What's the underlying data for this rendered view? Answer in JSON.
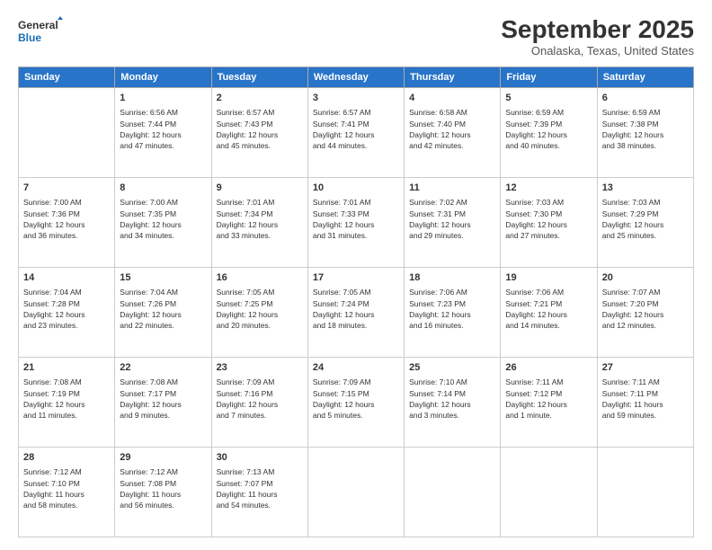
{
  "header": {
    "logo_line1": "General",
    "logo_line2": "Blue",
    "month_title": "September 2025",
    "location": "Onalaska, Texas, United States"
  },
  "days_of_week": [
    "Sunday",
    "Monday",
    "Tuesday",
    "Wednesday",
    "Thursday",
    "Friday",
    "Saturday"
  ],
  "weeks": [
    [
      {
        "day": "",
        "content": ""
      },
      {
        "day": "1",
        "content": "Sunrise: 6:56 AM\nSunset: 7:44 PM\nDaylight: 12 hours\nand 47 minutes."
      },
      {
        "day": "2",
        "content": "Sunrise: 6:57 AM\nSunset: 7:43 PM\nDaylight: 12 hours\nand 45 minutes."
      },
      {
        "day": "3",
        "content": "Sunrise: 6:57 AM\nSunset: 7:41 PM\nDaylight: 12 hours\nand 44 minutes."
      },
      {
        "day": "4",
        "content": "Sunrise: 6:58 AM\nSunset: 7:40 PM\nDaylight: 12 hours\nand 42 minutes."
      },
      {
        "day": "5",
        "content": "Sunrise: 6:59 AM\nSunset: 7:39 PM\nDaylight: 12 hours\nand 40 minutes."
      },
      {
        "day": "6",
        "content": "Sunrise: 6:59 AM\nSunset: 7:38 PM\nDaylight: 12 hours\nand 38 minutes."
      }
    ],
    [
      {
        "day": "7",
        "content": "Sunrise: 7:00 AM\nSunset: 7:36 PM\nDaylight: 12 hours\nand 36 minutes."
      },
      {
        "day": "8",
        "content": "Sunrise: 7:00 AM\nSunset: 7:35 PM\nDaylight: 12 hours\nand 34 minutes."
      },
      {
        "day": "9",
        "content": "Sunrise: 7:01 AM\nSunset: 7:34 PM\nDaylight: 12 hours\nand 33 minutes."
      },
      {
        "day": "10",
        "content": "Sunrise: 7:01 AM\nSunset: 7:33 PM\nDaylight: 12 hours\nand 31 minutes."
      },
      {
        "day": "11",
        "content": "Sunrise: 7:02 AM\nSunset: 7:31 PM\nDaylight: 12 hours\nand 29 minutes."
      },
      {
        "day": "12",
        "content": "Sunrise: 7:03 AM\nSunset: 7:30 PM\nDaylight: 12 hours\nand 27 minutes."
      },
      {
        "day": "13",
        "content": "Sunrise: 7:03 AM\nSunset: 7:29 PM\nDaylight: 12 hours\nand 25 minutes."
      }
    ],
    [
      {
        "day": "14",
        "content": "Sunrise: 7:04 AM\nSunset: 7:28 PM\nDaylight: 12 hours\nand 23 minutes."
      },
      {
        "day": "15",
        "content": "Sunrise: 7:04 AM\nSunset: 7:26 PM\nDaylight: 12 hours\nand 22 minutes."
      },
      {
        "day": "16",
        "content": "Sunrise: 7:05 AM\nSunset: 7:25 PM\nDaylight: 12 hours\nand 20 minutes."
      },
      {
        "day": "17",
        "content": "Sunrise: 7:05 AM\nSunset: 7:24 PM\nDaylight: 12 hours\nand 18 minutes."
      },
      {
        "day": "18",
        "content": "Sunrise: 7:06 AM\nSunset: 7:23 PM\nDaylight: 12 hours\nand 16 minutes."
      },
      {
        "day": "19",
        "content": "Sunrise: 7:06 AM\nSunset: 7:21 PM\nDaylight: 12 hours\nand 14 minutes."
      },
      {
        "day": "20",
        "content": "Sunrise: 7:07 AM\nSunset: 7:20 PM\nDaylight: 12 hours\nand 12 minutes."
      }
    ],
    [
      {
        "day": "21",
        "content": "Sunrise: 7:08 AM\nSunset: 7:19 PM\nDaylight: 12 hours\nand 11 minutes."
      },
      {
        "day": "22",
        "content": "Sunrise: 7:08 AM\nSunset: 7:17 PM\nDaylight: 12 hours\nand 9 minutes."
      },
      {
        "day": "23",
        "content": "Sunrise: 7:09 AM\nSunset: 7:16 PM\nDaylight: 12 hours\nand 7 minutes."
      },
      {
        "day": "24",
        "content": "Sunrise: 7:09 AM\nSunset: 7:15 PM\nDaylight: 12 hours\nand 5 minutes."
      },
      {
        "day": "25",
        "content": "Sunrise: 7:10 AM\nSunset: 7:14 PM\nDaylight: 12 hours\nand 3 minutes."
      },
      {
        "day": "26",
        "content": "Sunrise: 7:11 AM\nSunset: 7:12 PM\nDaylight: 12 hours\nand 1 minute."
      },
      {
        "day": "27",
        "content": "Sunrise: 7:11 AM\nSunset: 7:11 PM\nDaylight: 11 hours\nand 59 minutes."
      }
    ],
    [
      {
        "day": "28",
        "content": "Sunrise: 7:12 AM\nSunset: 7:10 PM\nDaylight: 11 hours\nand 58 minutes."
      },
      {
        "day": "29",
        "content": "Sunrise: 7:12 AM\nSunset: 7:08 PM\nDaylight: 11 hours\nand 56 minutes."
      },
      {
        "day": "30",
        "content": "Sunrise: 7:13 AM\nSunset: 7:07 PM\nDaylight: 11 hours\nand 54 minutes."
      },
      {
        "day": "",
        "content": ""
      },
      {
        "day": "",
        "content": ""
      },
      {
        "day": "",
        "content": ""
      },
      {
        "day": "",
        "content": ""
      }
    ]
  ]
}
